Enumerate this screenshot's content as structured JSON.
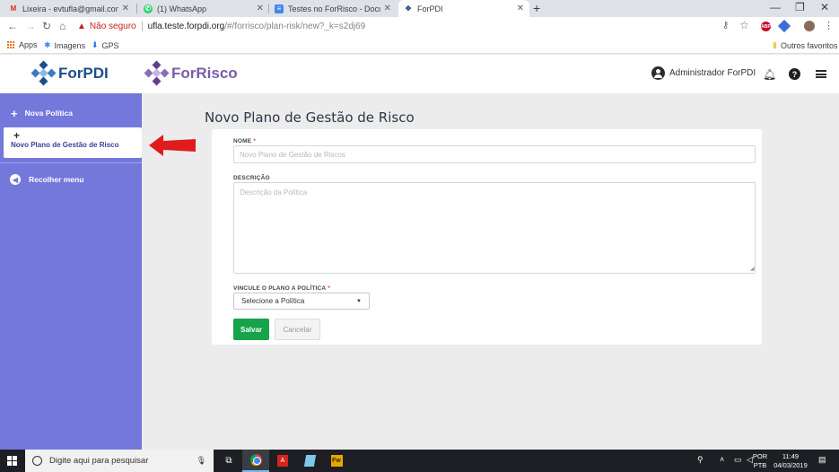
{
  "browser": {
    "tabs": [
      {
        "title": "Lixeira - evtufla@gmail.com - Gm",
        "icon": "gmail-icon",
        "active": false
      },
      {
        "title": "(1) WhatsApp",
        "icon": "whatsapp-icon",
        "active": false
      },
      {
        "title": "Testes no ForRisco - Documentos",
        "icon": "docs-icon",
        "active": false
      },
      {
        "title": "ForPDI",
        "icon": "forpdi-icon",
        "active": true
      }
    ],
    "security_label": "Não seguro",
    "url_host": "ufla.teste.forpdi.org",
    "url_path": "/#/forrisco/plan-risk/new?_k=s2dj69",
    "bookmarks": [
      {
        "label": "Apps"
      },
      {
        "label": "Imagens"
      },
      {
        "label": "GPS"
      }
    ],
    "other_bookmarks": "Outros favoritos",
    "ext_abp": "ABP"
  },
  "app": {
    "logo_forpdi_for": "For",
    "logo_forpdi_pdi": "PDI",
    "logo_forrisco_for": "For",
    "logo_forrisco_risco": "Risco",
    "user_name": "Administrador ForPDI",
    "help_glyph": "?"
  },
  "sidebar": {
    "new_policy": "Nova Política",
    "new_plan": "Novo Plano de Gestão de Risco",
    "collapse": "Recolher menu"
  },
  "form": {
    "page_title": "Novo Plano de Gestão de Risco",
    "name_label": "NOME",
    "name_placeholder": "Novo Plano de Gestão de Riscos",
    "description_label": "DESCRIÇÃO",
    "description_placeholder": "Descrição da Política",
    "policy_label": "VINCULE O PLANO A POLÍTICA",
    "policy_selected": "Selecione a Política",
    "required_mark": "*",
    "save_label": "Salvar",
    "cancel_label": "Cancelar"
  },
  "taskbar": {
    "search_placeholder": "Digite aqui para pesquisar",
    "language": "POR",
    "layout": "PTB",
    "time": "11:49",
    "date": "04/03/2019",
    "fw_label": "Fw",
    "pdf_label": "A"
  },
  "colors": {
    "sidebar": "#7478db",
    "save_button": "#16a34a",
    "annotation_arrow": "#e01b1b",
    "forpdi_blue": "#1c4e8a",
    "forrisco_purple": "#7b5ca8"
  }
}
